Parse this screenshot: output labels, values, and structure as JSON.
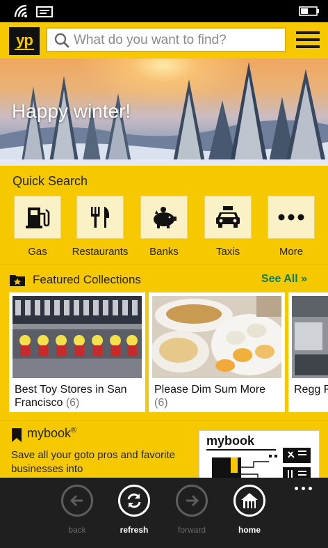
{
  "header": {
    "logo_text": "yp",
    "search_placeholder": "What do you want to find?"
  },
  "hero": {
    "title": "Happy winter!"
  },
  "quick_search": {
    "title": "Quick Search",
    "items": [
      {
        "label": "Gas",
        "icon": "gas-pump-icon"
      },
      {
        "label": "Restaurants",
        "icon": "fork-knife-icon"
      },
      {
        "label": "Banks",
        "icon": "piggy-bank-icon"
      },
      {
        "label": "Taxis",
        "icon": "taxi-icon"
      },
      {
        "label": "More",
        "icon": "more-dots-icon"
      }
    ]
  },
  "featured": {
    "title": "Featured Collections",
    "see_all": "See All »",
    "cards": [
      {
        "title": "Best Toy Stores in San Francisco",
        "count": "(6)"
      },
      {
        "title": "Please Dim Sum More",
        "count": "(6)"
      },
      {
        "title": "Regg Franc",
        "count": ""
      }
    ]
  },
  "mybook": {
    "title": "mybook",
    "mark": "®",
    "description": "Save all your goto pros and favorite businesses into",
    "promo_title": "mybook"
  },
  "app_bar": {
    "buttons": [
      {
        "label": "back",
        "enabled": false
      },
      {
        "label": "refresh",
        "enabled": true
      },
      {
        "label": "forward",
        "enabled": false
      },
      {
        "label": "home",
        "enabled": true
      }
    ]
  },
  "colors": {
    "brand_yellow": "#f5c800",
    "see_all_green": "#0a7d5a",
    "app_bar_bg": "#1f1f1f"
  }
}
